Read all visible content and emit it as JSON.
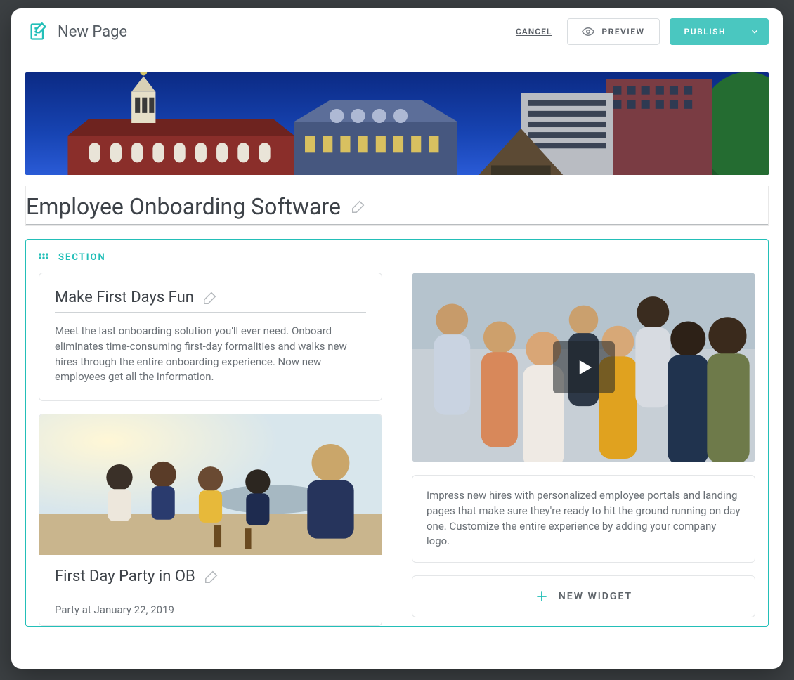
{
  "header": {
    "title": "New Page",
    "cancel": "CANCEL",
    "preview": "PREVIEW",
    "publish": "PUBLISH"
  },
  "page": {
    "heading": "Employee Onboarding Software"
  },
  "section": {
    "label": "SECTION",
    "left": {
      "card1": {
        "title": "Make First Days Fun",
        "body": "Meet the last onboarding solution you'll ever need. Onboard eliminates time-consuming first-day formalities and walks new hires through the entire onboarding experience. Now new employees get all the information."
      },
      "card2": {
        "title": "First Day Party in OB",
        "body": "Party at January 22, 2019"
      }
    },
    "right": {
      "textcard": {
        "body": "Impress new hires with personalized employee portals and landing pages that make sure they're ready to hit the ground running on day one. Customize the entire experience by adding your company logo."
      },
      "new_widget": "NEW WIDGET"
    }
  }
}
